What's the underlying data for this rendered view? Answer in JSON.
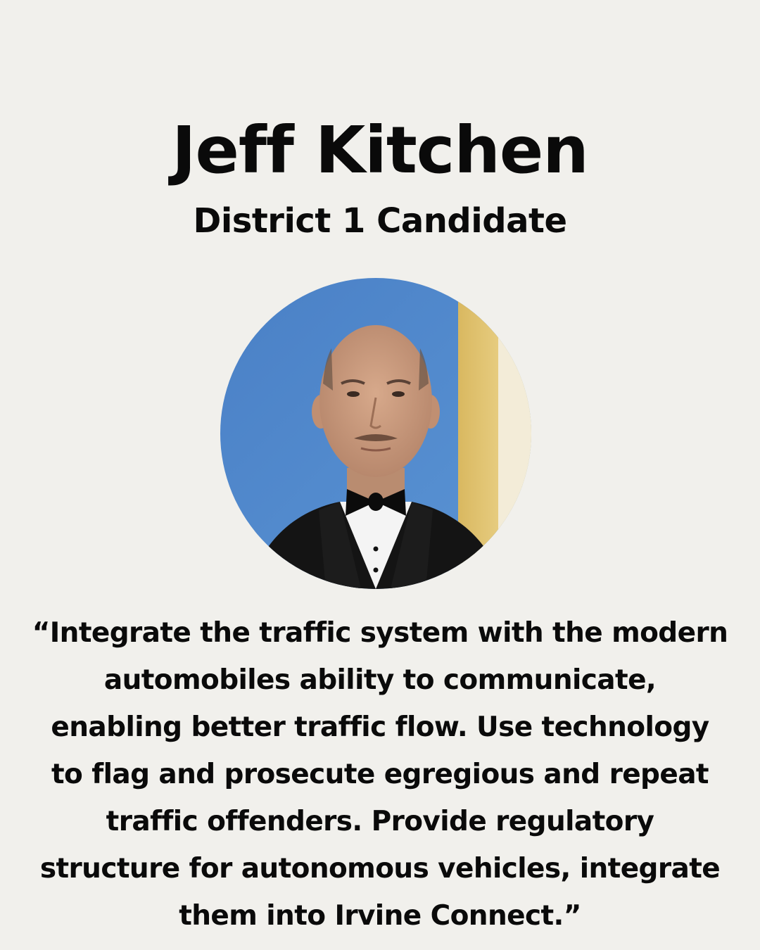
{
  "candidate": {
    "name": "Jeff Kitchen",
    "title": "District 1 Candidate"
  },
  "photo": {
    "icon": "candidate-portrait",
    "colors": {
      "background_wall": "#4f86c9",
      "door_frame": "#e8cf7a",
      "skin": "#c99a7c",
      "tuxedo": "#141414",
      "shirt": "#f4f4f4"
    }
  },
  "quote": {
    "lines": [
      "“Integrate the traffic system with the modern",
      "automobiles ability to communicate,",
      "enabling better traffic flow. Use technology",
      "to flag and prosecute egregious and repeat",
      "traffic offenders. Provide regulatory",
      "structure for autonomous vehicles, integrate",
      "them into Irvine Connect.”"
    ]
  },
  "colors": {
    "page_background": "#f1f0ec",
    "text": "#0a0a0a"
  }
}
